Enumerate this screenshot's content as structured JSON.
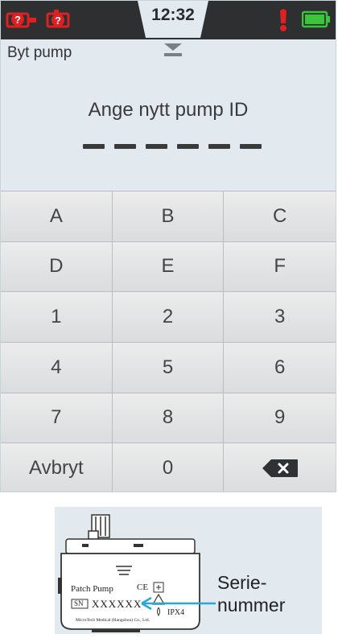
{
  "status_bar": {
    "time": "12:32",
    "icons": [
      "pump-error-icon",
      "sensor-error-icon",
      "alarm-icon",
      "battery-icon"
    ],
    "colors": {
      "error": "#e02020",
      "battery": "#3cc43c",
      "bar": "#2d2f31"
    }
  },
  "header": {
    "title": "Byt pump"
  },
  "prompt": {
    "text": "Ange nytt pump ID",
    "digits": 6
  },
  "keypad": {
    "keys": [
      "A",
      "B",
      "C",
      "D",
      "E",
      "F",
      "1",
      "2",
      "3",
      "4",
      "5",
      "6",
      "7",
      "8",
      "9",
      "Avbryt",
      "0"
    ],
    "backspace_icon": "backspace-icon"
  },
  "illustration": {
    "product": "Patch Pump",
    "sn_tag": "SN",
    "serial": "XXXXXX",
    "ip_rating": "IPX4",
    "ce_mark": "CE",
    "manufacturer": "MicroTech Medical (Hangzhou) Co., Ltd.",
    "callout_line1": "Serie-",
    "callout_line2": "nummer",
    "arrow_color": "#2aa7d8"
  }
}
